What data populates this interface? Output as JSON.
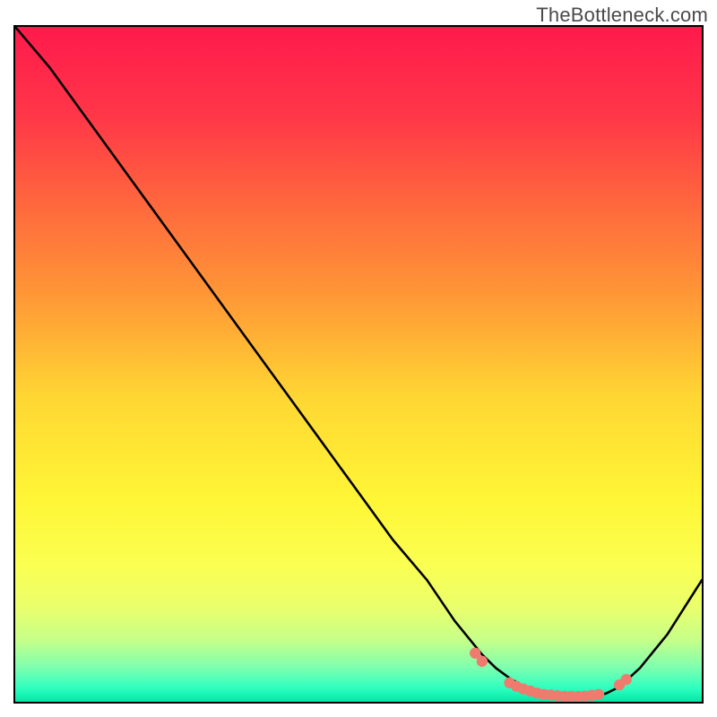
{
  "watermark": "TheBottleneck.com",
  "chart_data": {
    "type": "line",
    "title": "",
    "xlabel": "",
    "ylabel": "",
    "xlim": [
      0,
      100
    ],
    "ylim": [
      0,
      100
    ],
    "grid": false,
    "series": [
      {
        "name": "curve",
        "x": [
          0,
          5,
          10,
          15,
          20,
          25,
          30,
          35,
          40,
          45,
          50,
          55,
          60,
          64,
          68,
          70,
          72,
          74,
          76,
          78,
          80,
          82,
          84,
          86,
          88,
          91,
          95,
          100
        ],
        "y": [
          100,
          94,
          87,
          80,
          73,
          66,
          59,
          52,
          45,
          38,
          31,
          24,
          18,
          12,
          7,
          5,
          3.5,
          2.3,
          1.5,
          1,
          0.8,
          0.8,
          0.9,
          1.2,
          2.2,
          5,
          10,
          18
        ]
      }
    ],
    "markers": {
      "comment": "salmon dots along trough",
      "x": [
        67,
        68,
        72,
        73,
        74,
        75,
        76,
        77,
        78,
        79,
        80,
        81,
        82,
        83,
        84,
        85,
        88,
        89
      ],
      "y": [
        7.2,
        6.0,
        2.8,
        2.3,
        1.9,
        1.6,
        1.3,
        1.1,
        1.0,
        0.9,
        0.8,
        0.8,
        0.8,
        0.85,
        0.95,
        1.1,
        2.5,
        3.3
      ]
    },
    "background_gradient_stops": [
      {
        "offset": 0.0,
        "color": "#ff1a4c"
      },
      {
        "offset": 0.13,
        "color": "#ff3648"
      },
      {
        "offset": 0.27,
        "color": "#ff6a3d"
      },
      {
        "offset": 0.4,
        "color": "#ff9836"
      },
      {
        "offset": 0.55,
        "color": "#ffd733"
      },
      {
        "offset": 0.7,
        "color": "#fff636"
      },
      {
        "offset": 0.8,
        "color": "#faff52"
      },
      {
        "offset": 0.86,
        "color": "#eaff6c"
      },
      {
        "offset": 0.91,
        "color": "#c4ff8a"
      },
      {
        "offset": 0.95,
        "color": "#7cffb0"
      },
      {
        "offset": 0.98,
        "color": "#2effc0"
      },
      {
        "offset": 1.0,
        "color": "#00e8a6"
      }
    ],
    "marker_color": "#ee7b6e",
    "curve_color": "#000000"
  }
}
